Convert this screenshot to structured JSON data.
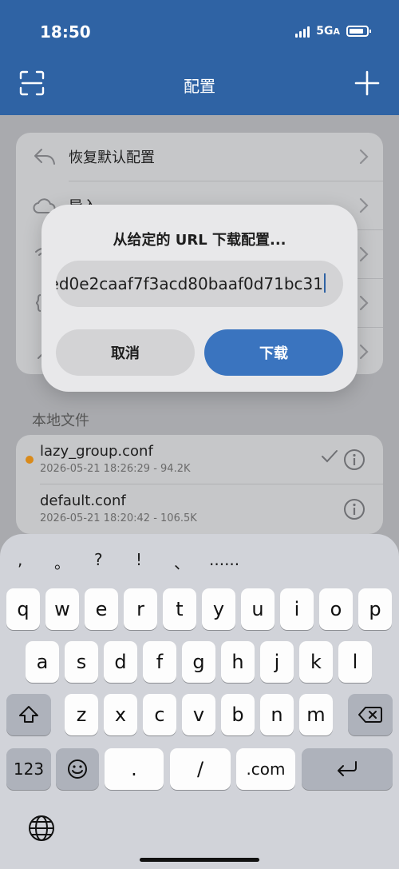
{
  "status": {
    "time": "18:50",
    "network": "5G",
    "network_suffix": "A"
  },
  "nav": {
    "title": "配置"
  },
  "menu": [
    {
      "label": "恢复默认配置",
      "icon": "undo-icon"
    },
    {
      "label": "导入",
      "icon": "cloud-icon"
    },
    {
      "label": "",
      "icon": "wifi-icon"
    },
    {
      "label": "",
      "icon": "code-icon"
    },
    {
      "label": "",
      "icon": "tool-icon"
    }
  ],
  "local": {
    "section_title": "本地文件",
    "files": [
      {
        "name": "lazy_group.conf",
        "meta": "2026-05-21 18:26:29 - 94.2K",
        "active": true
      },
      {
        "name": "default.conf",
        "meta": "2026-05-21 18:20:42 - 106.5K",
        "active": false
      }
    ]
  },
  "dialog": {
    "title": "从给定的 URL 下载配置...",
    "input_value": "ed0e2caaf7f3acd80baaf0d71bc31",
    "cancel_label": "取消",
    "download_label": "下载"
  },
  "keyboard": {
    "punct": [
      ",",
      "。",
      "?",
      "!",
      "、",
      "......"
    ],
    "row1": [
      "q",
      "w",
      "e",
      "r",
      "t",
      "y",
      "u",
      "i",
      "o",
      "p"
    ],
    "row2": [
      "a",
      "s",
      "d",
      "f",
      "g",
      "h",
      "j",
      "k",
      "l"
    ],
    "row3": [
      "z",
      "x",
      "c",
      "v",
      "b",
      "n",
      "m"
    ],
    "numbers_label": "123",
    "dot_label": ".",
    "slash_label": "/",
    "dotcom_label": ".com"
  },
  "colors": {
    "accent": "#2f63a4",
    "button": "#3a74bf",
    "dot": "#d98a1a"
  }
}
